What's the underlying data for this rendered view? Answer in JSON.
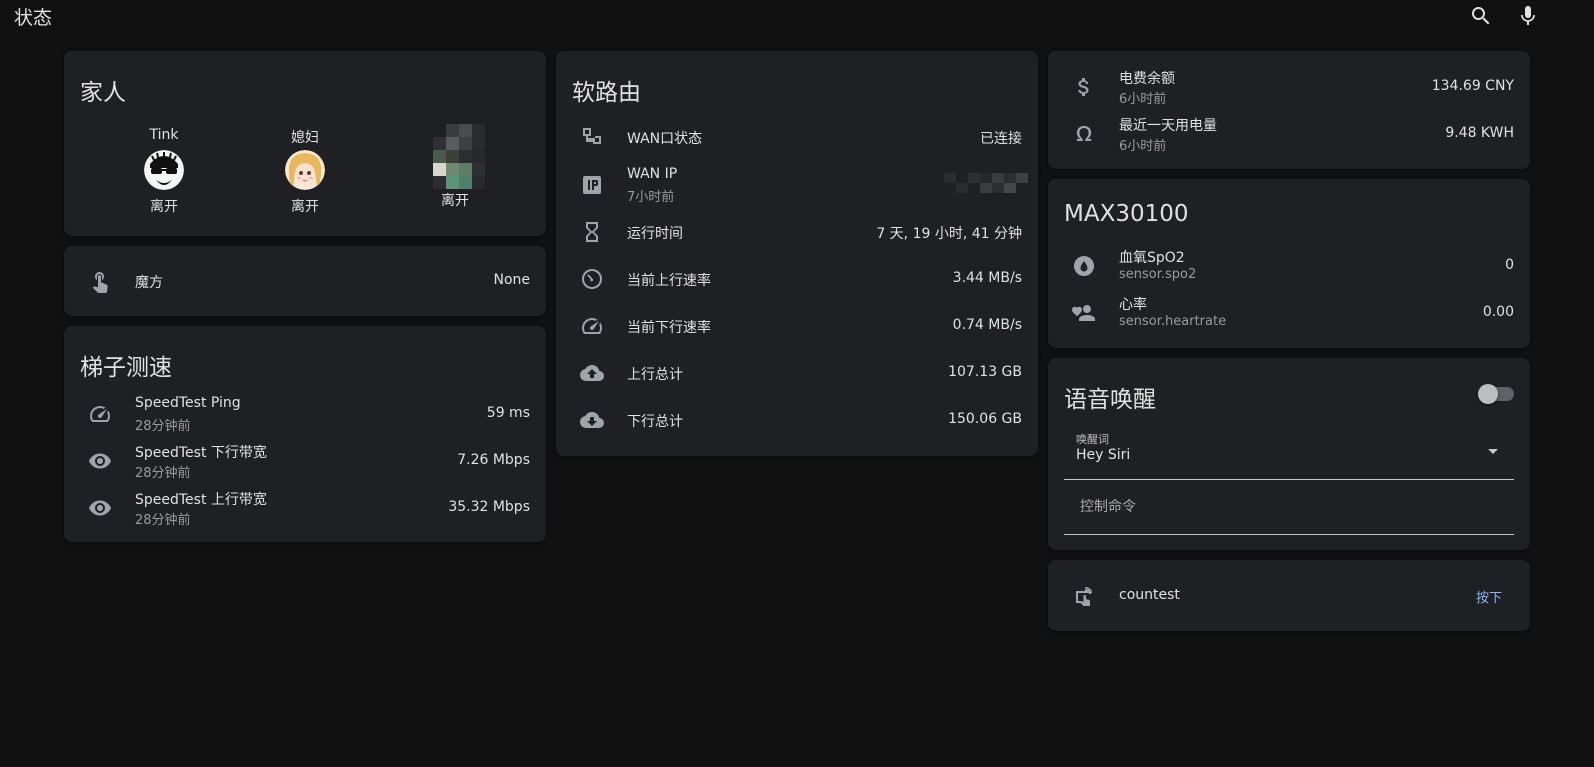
{
  "app": {
    "title": "状态"
  },
  "family": {
    "title": "家人",
    "members": [
      {
        "name": "Tink",
        "state": "离开"
      },
      {
        "name": "媳妇",
        "state": "离开"
      },
      {
        "name": "",
        "state": "离开"
      }
    ]
  },
  "cube": {
    "name": "魔方",
    "value": "None"
  },
  "speedtest": {
    "title": "梯子测速",
    "rows": [
      {
        "name": "SpeedTest Ping",
        "sub": "28分钟前",
        "value": "59 ms"
      },
      {
        "name": "SpeedTest 下行带宽",
        "sub": "28分钟前",
        "value": "7.26 Mbps"
      },
      {
        "name": "SpeedTest 上行带宽",
        "sub": "28分钟前",
        "value": "35.32 Mbps"
      }
    ]
  },
  "router": {
    "title": "软路由",
    "rows": [
      {
        "name": "WAN口状态",
        "value": "已连接"
      },
      {
        "name": "WAN IP",
        "sub": "7小时前",
        "value": ""
      },
      {
        "name": "运行时间",
        "value": "7 天, 19 小时, 41 分钟"
      },
      {
        "name": "当前上行速率",
        "value": "3.44 MB/s"
      },
      {
        "name": "当前下行速率",
        "value": "0.74 MB/s"
      },
      {
        "name": "上行总计",
        "value": "107.13 GB"
      },
      {
        "name": "下行总计",
        "value": "150.06 GB"
      }
    ]
  },
  "power": {
    "rows": [
      {
        "name": "电费余额",
        "sub": "6小时前",
        "value": "134.69 CNY"
      },
      {
        "name": "最近一天用电量",
        "sub": "6小时前",
        "value": "9.48 KWH"
      }
    ]
  },
  "max30100": {
    "title": "MAX30100",
    "rows": [
      {
        "name": "血氧SpO2",
        "sub": "sensor.spo2",
        "value": "0"
      },
      {
        "name": "心率",
        "sub": "sensor.heartrate",
        "value": "0.00"
      }
    ]
  },
  "voice": {
    "title": "语音唤醒",
    "toggle_on": false,
    "wake_word_label": "唤醒词",
    "wake_word_value": "Hey Siri",
    "command_placeholder": "控制命令"
  },
  "countest": {
    "name": "countest",
    "button_label": "按下"
  },
  "colors": {
    "background": "#111111",
    "card": "#1f2023",
    "accent": "#8ab4f8",
    "icon": "#9fa3aa"
  }
}
